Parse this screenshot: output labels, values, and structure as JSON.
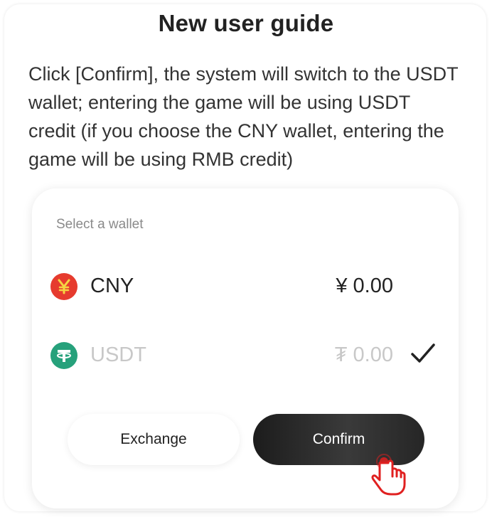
{
  "dialog": {
    "title": "New user guide",
    "description": "Click [Confirm], the system will switch to the USDT wallet; entering the game will be using USDT credit (if you choose the CNY wallet, entering the game will be using RMB credit)"
  },
  "wallet_card": {
    "label": "Select a wallet",
    "wallets": [
      {
        "name": "CNY",
        "amount": "¥  0.00",
        "icon": "cny-coin-icon",
        "color": "#e63b2e",
        "selected": false
      },
      {
        "name": "USDT",
        "amount": "₮ 0.00",
        "icon": "usdt-coin-icon",
        "color": "#26a17b",
        "selected": true
      }
    ]
  },
  "buttons": {
    "exchange_label": "Exchange",
    "confirm_label": "Confirm"
  },
  "icons": {
    "check": "checkmark-icon",
    "pointer": "pointing-hand-icon"
  },
  "colors": {
    "accent_dark": "#222222",
    "cny": "#e63b2e",
    "usdt": "#26a17b",
    "pointer": "#e02020"
  }
}
